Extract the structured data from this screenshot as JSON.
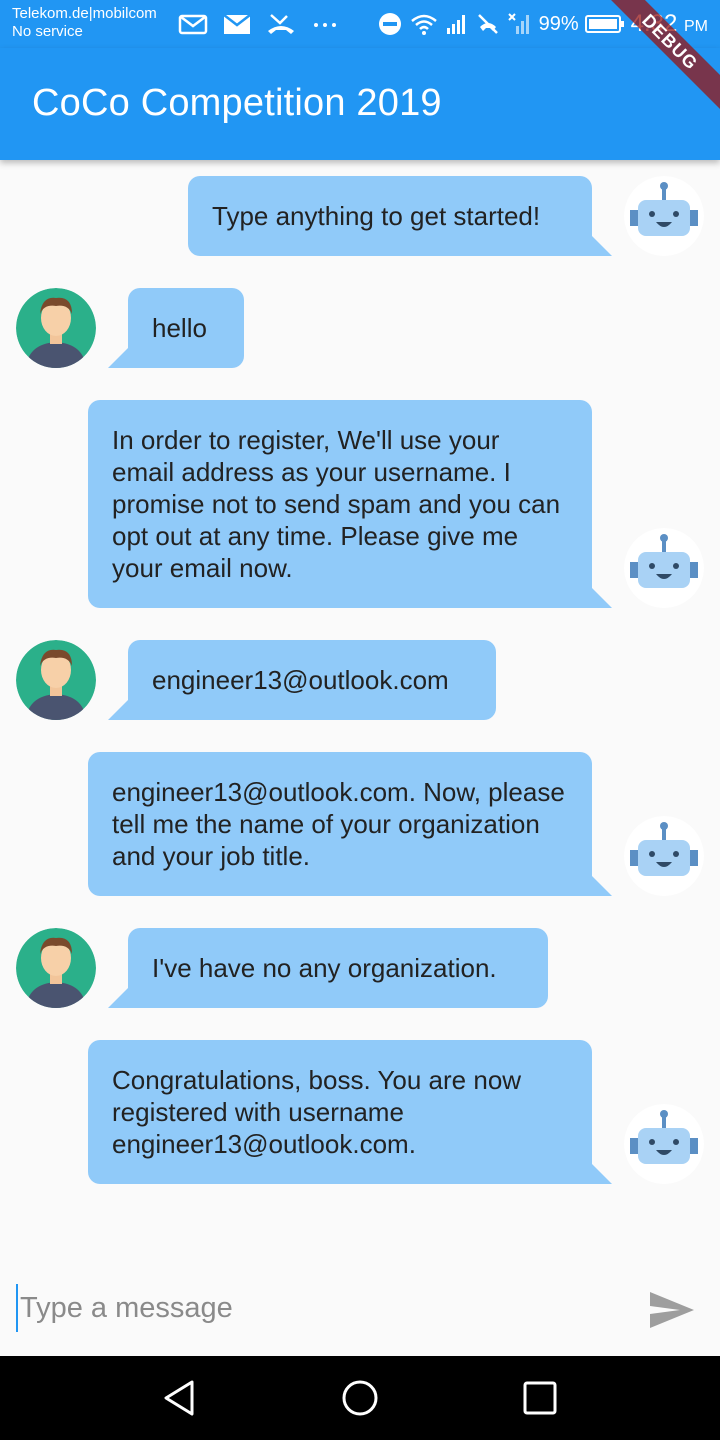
{
  "status_bar": {
    "carrier_line1": "Telekom.de|mobilcom",
    "carrier_line2": "No service",
    "battery": "99%",
    "time": "4:32",
    "ampm": "PM",
    "icons": [
      "gmail-icon",
      "mail-icon",
      "missed-call-icon",
      "more-dots-icon",
      "do-not-disturb-icon",
      "wifi-icon",
      "signal-icon",
      "no-call-icon",
      "no-signal-icon",
      "battery-icon"
    ]
  },
  "debug_label": "DEBUG",
  "app_bar": {
    "title": "CoCo Competition 2019"
  },
  "messages": [
    {
      "sender": "bot",
      "text": "Type anything to get started!"
    },
    {
      "sender": "user",
      "text": "hello"
    },
    {
      "sender": "bot",
      "text": "In order to register, We'll use your email address as your username. I promise not to send spam and you can opt out at any time.  Please give me your email now."
    },
    {
      "sender": "user",
      "text": "engineer13@outlook.com"
    },
    {
      "sender": "bot",
      "text": "engineer13@outlook.com. Now, please tell me the name of your organization and your job title."
    },
    {
      "sender": "user",
      "text": "I've have no any organization."
    },
    {
      "sender": "bot",
      "text": "Congratulations, boss. You are now registered with username engineer13@outlook.com."
    }
  ],
  "composer": {
    "placeholder": "Type a message",
    "value": ""
  },
  "colors": {
    "primary": "#2196f3",
    "bubble": "#90caf9",
    "background": "#fafafa"
  },
  "nav_bar": {
    "icons": [
      "back-icon",
      "home-icon",
      "recents-icon"
    ]
  }
}
